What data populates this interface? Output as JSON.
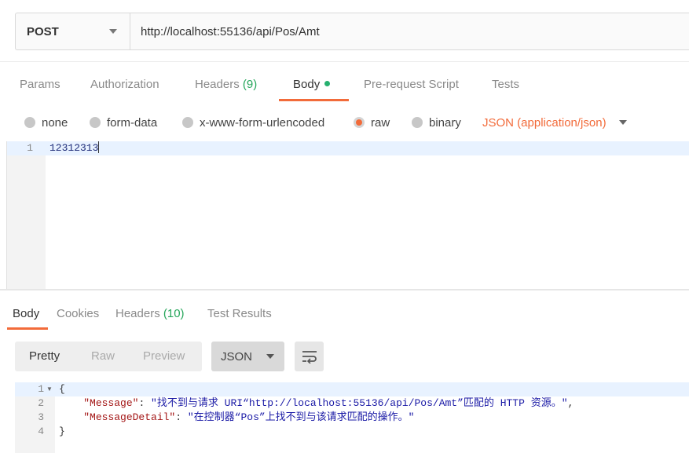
{
  "request": {
    "method": "POST",
    "url": "http://localhost:55136/api/Pos/Amt"
  },
  "request_tabs": {
    "params": "Params",
    "authorization": "Authorization",
    "headers": "Headers",
    "headers_count": "(9)",
    "body": "Body",
    "prerequest": "Pre-request Script",
    "tests": "Tests"
  },
  "body_types": {
    "none": "none",
    "form_data": "form-data",
    "urlencoded": "x-www-form-urlencoded",
    "raw": "raw",
    "binary": "binary",
    "selected": "raw",
    "content_type": "JSON (application/json)"
  },
  "request_body": {
    "line_number": "1",
    "text": "12312313"
  },
  "response_tabs": {
    "body": "Body",
    "cookies": "Cookies",
    "headers": "Headers",
    "headers_count": "(10)",
    "test_results": "Test Results"
  },
  "response_view": {
    "pretty": "Pretty",
    "raw": "Raw",
    "preview": "Preview",
    "format": "JSON"
  },
  "response_body": {
    "line_numbers": [
      "1",
      "2",
      "3",
      "4"
    ],
    "open_brace": "{",
    "close_brace": "}",
    "key1": "\"Message\"",
    "val1": "\"找不到与请求 URI“http://localhost:55136/api/Pos/Amt”匹配的 HTTP 资源。\"",
    "key2": "\"MessageDetail\"",
    "val2": "\"在控制器“Pos”上找不到与该请求匹配的操作。\""
  },
  "colors": {
    "accent": "#f26b3a",
    "count_green": "#26a65b",
    "dot_green": "#26b06f"
  }
}
